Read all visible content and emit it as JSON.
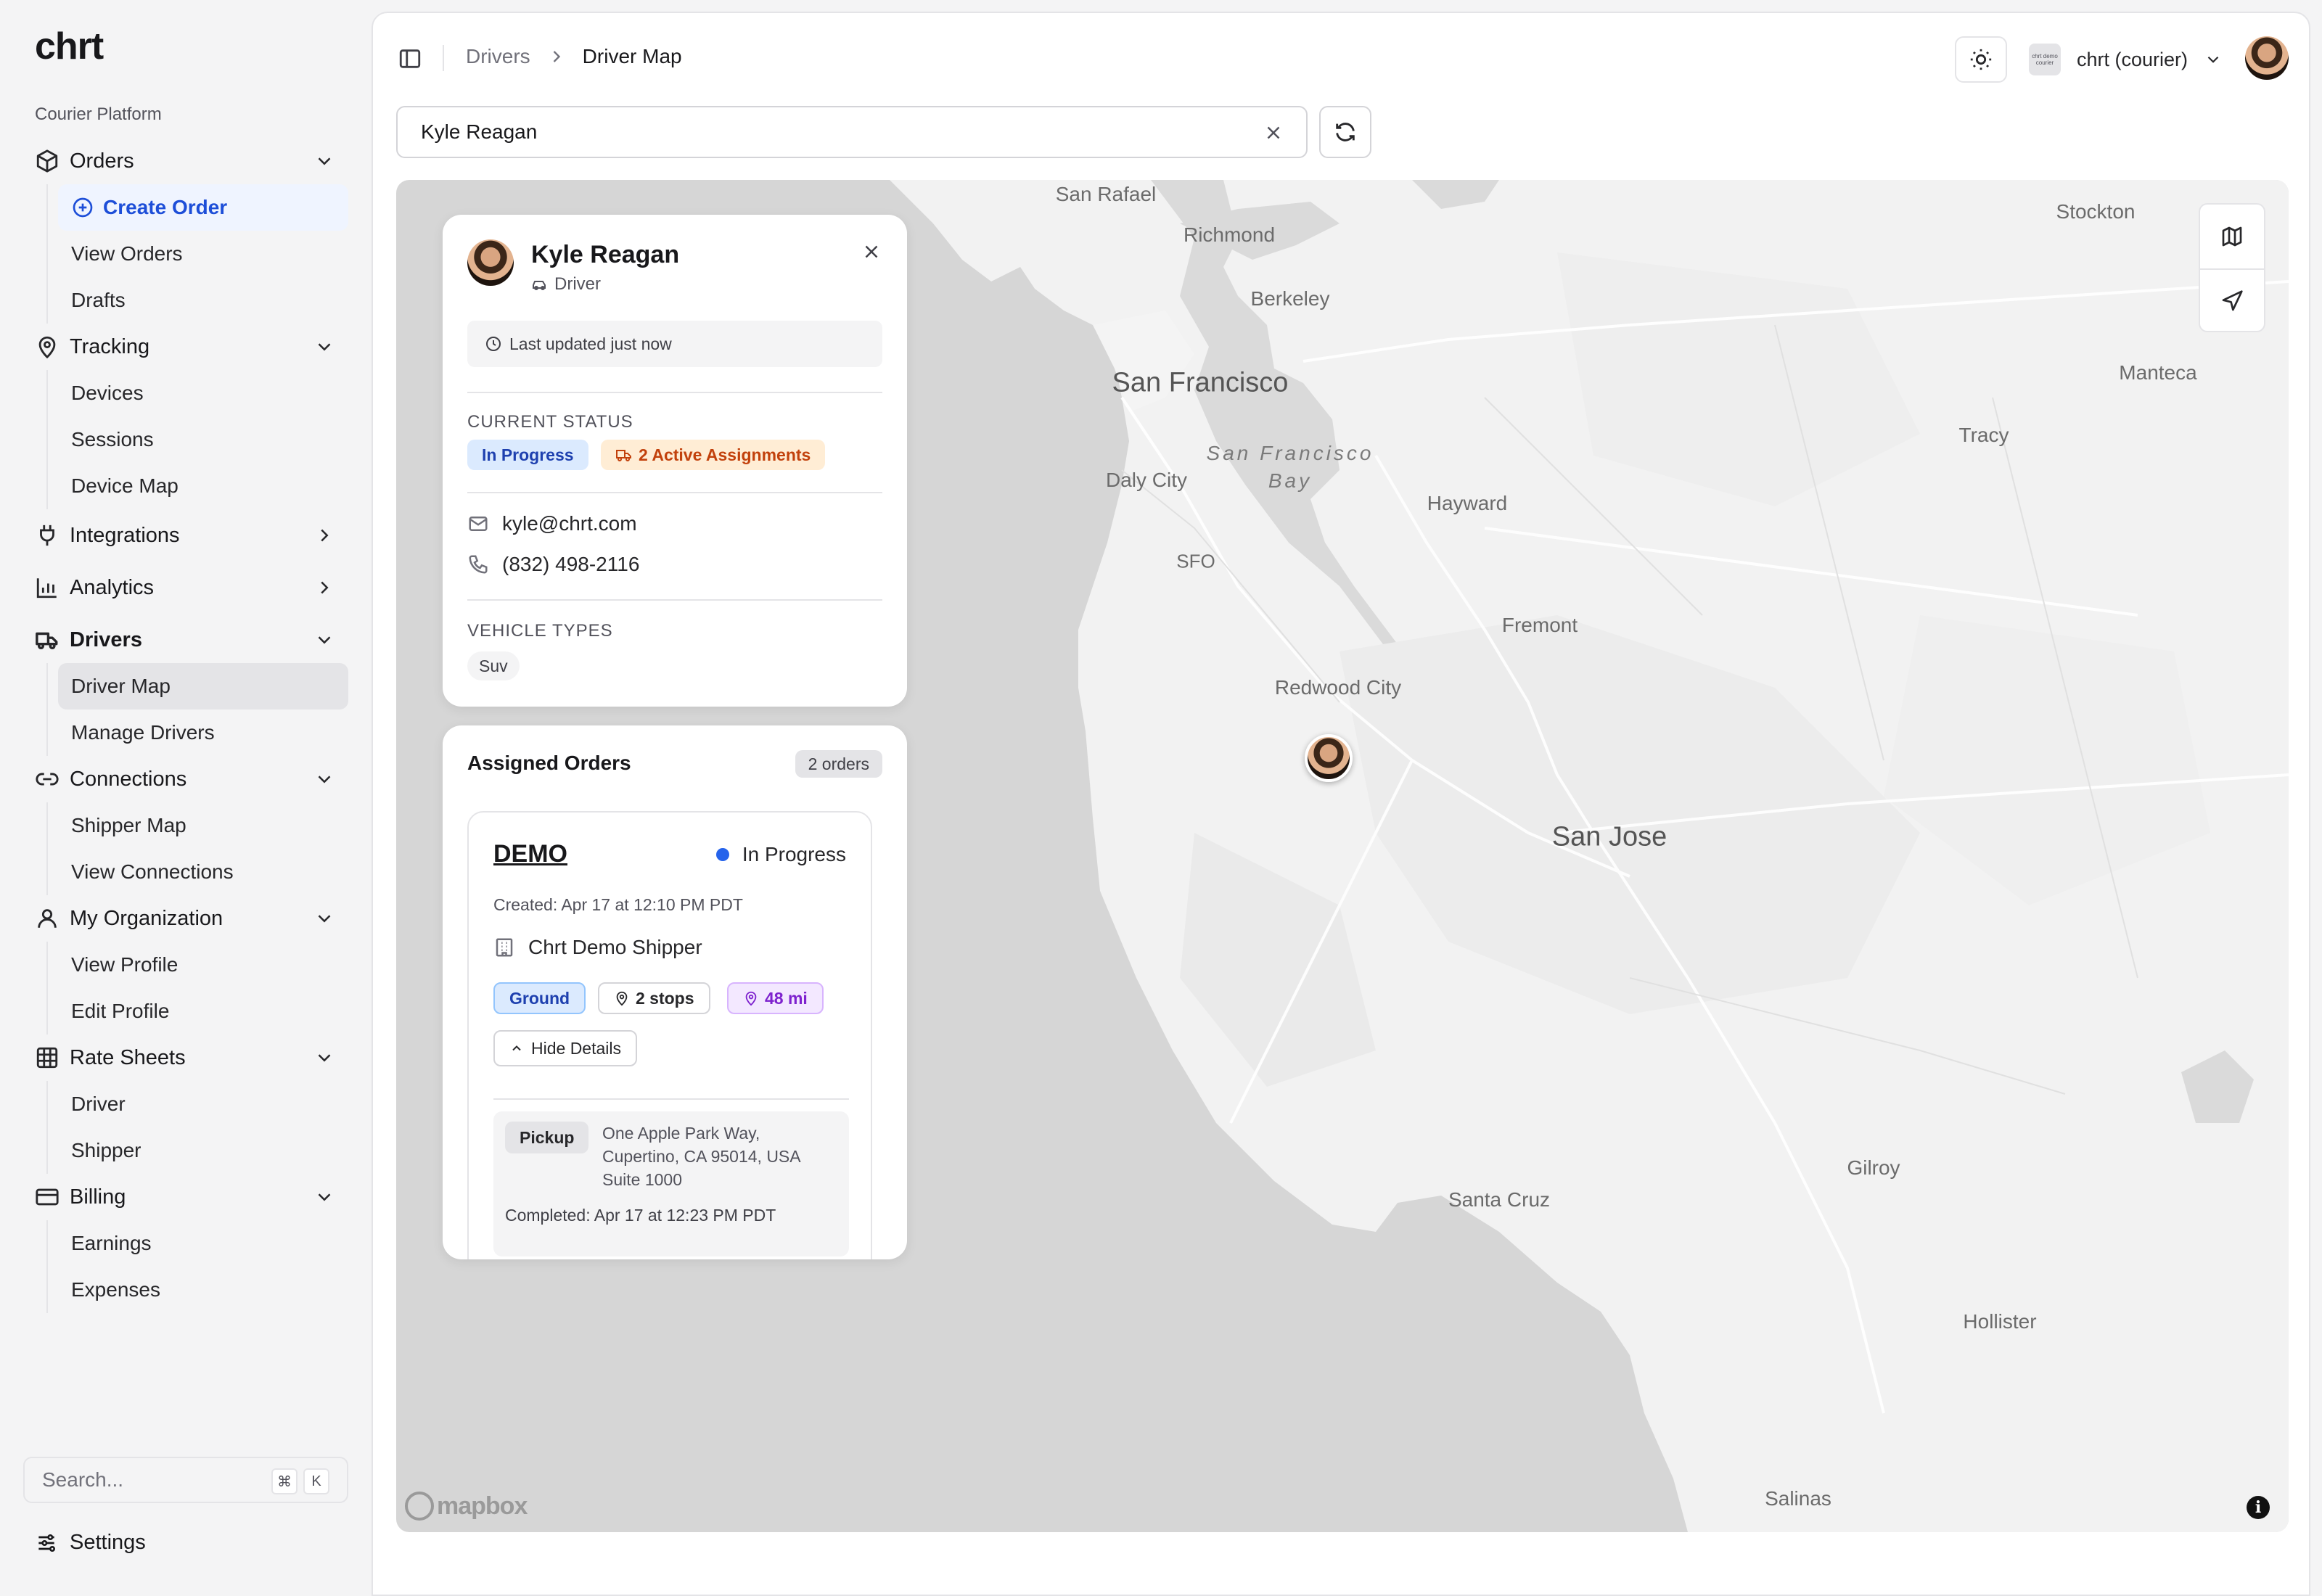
{
  "app": {
    "logo": "chrt",
    "platform_label": "Courier Platform"
  },
  "sidebar": {
    "groups": [
      {
        "label": "Orders",
        "icon": "box-icon",
        "expanded": true,
        "items": [
          {
            "label": "Create Order",
            "primary": true
          },
          {
            "label": "View Orders"
          },
          {
            "label": "Drafts"
          }
        ]
      },
      {
        "label": "Tracking",
        "icon": "map-pin-icon",
        "expanded": true,
        "items": [
          {
            "label": "Devices"
          },
          {
            "label": "Sessions"
          },
          {
            "label": "Device Map"
          }
        ]
      },
      {
        "label": "Integrations",
        "icon": "plug-icon",
        "expanded": false,
        "items": []
      },
      {
        "label": "Analytics",
        "icon": "bar-chart-icon",
        "expanded": false,
        "items": []
      },
      {
        "label": "Drivers",
        "icon": "truck-icon",
        "expanded": true,
        "active": true,
        "items": [
          {
            "label": "Driver Map",
            "active": true
          },
          {
            "label": "Manage Drivers"
          }
        ]
      },
      {
        "label": "Connections",
        "icon": "link-icon",
        "expanded": true,
        "items": [
          {
            "label": "Shipper Map"
          },
          {
            "label": "View Connections"
          }
        ]
      },
      {
        "label": "My Organization",
        "icon": "user-icon",
        "expanded": true,
        "items": [
          {
            "label": "View Profile"
          },
          {
            "label": "Edit Profile"
          }
        ]
      },
      {
        "label": "Rate Sheets",
        "icon": "table-icon",
        "expanded": true,
        "items": [
          {
            "label": "Driver"
          },
          {
            "label": "Shipper"
          }
        ]
      },
      {
        "label": "Billing",
        "icon": "credit-card-icon",
        "expanded": true,
        "items": [
          {
            "label": "Earnings"
          },
          {
            "label": "Expenses"
          }
        ]
      }
    ],
    "search": {
      "placeholder": "Search...",
      "kbd_mod": "⌘",
      "kbd_key": "K"
    },
    "settings_label": "Settings"
  },
  "header": {
    "breadcrumbs": [
      "Drivers",
      "Driver Map"
    ],
    "org_name": "chrt (courier)",
    "org_logo_text": "chrt demo courier"
  },
  "search": {
    "value": "Kyle Reagan"
  },
  "map": {
    "labels": [
      {
        "text": "San Rafael",
        "size": "med"
      },
      {
        "text": "Richmond",
        "size": "med"
      },
      {
        "text": "Berkeley",
        "size": "med"
      },
      {
        "text": "Stockton",
        "size": "med"
      },
      {
        "text": "San Francisco",
        "size": "big"
      },
      {
        "text": "San Francisco\nBay",
        "size": "bay"
      },
      {
        "text": "Daly City",
        "size": "med"
      },
      {
        "text": "Hayward",
        "size": "med"
      },
      {
        "text": "Manteca",
        "size": "med"
      },
      {
        "text": "Tracy",
        "size": "med"
      },
      {
        "text": "SFO",
        "size": "sm"
      },
      {
        "text": "Fremont",
        "size": "med"
      },
      {
        "text": "Redwood City",
        "size": "med"
      },
      {
        "text": "San Jose",
        "size": "big"
      },
      {
        "text": "Santa Cruz",
        "size": "med"
      },
      {
        "text": "Gilroy",
        "size": "med"
      },
      {
        "text": "Hollister",
        "size": "med"
      },
      {
        "text": "Salinas",
        "size": "med"
      }
    ],
    "attribution": "mapbox",
    "info": "i"
  },
  "driver": {
    "name": "Kyle Reagan",
    "role": "Driver",
    "last_updated": "Last updated just now",
    "status_label": "CURRENT STATUS",
    "status": "In Progress",
    "active_assignments": "2 Active Assignments",
    "email": "kyle@chrt.com",
    "phone": "(832) 498-2116",
    "vehicle_label": "VEHICLE TYPES",
    "vehicle_types": [
      "Suv"
    ]
  },
  "assigned_orders": {
    "title": "Assigned Orders",
    "count": "2 orders",
    "orders": [
      {
        "id": "DEMO",
        "status": "In Progress",
        "created": "Created: Apr 17 at 12:10 PM PDT",
        "shipper": "Chrt Demo Shipper",
        "service": "Ground",
        "stops": "2 stops",
        "distance": "48 mi",
        "toggle_label": "Hide Details",
        "stop": {
          "type": "Pickup",
          "address": "One Apple Park Way, Cupertino, CA 95014, USA Suite 1000",
          "completed": "Completed: Apr 17 at 12:23 PM PDT"
        }
      }
    ]
  }
}
